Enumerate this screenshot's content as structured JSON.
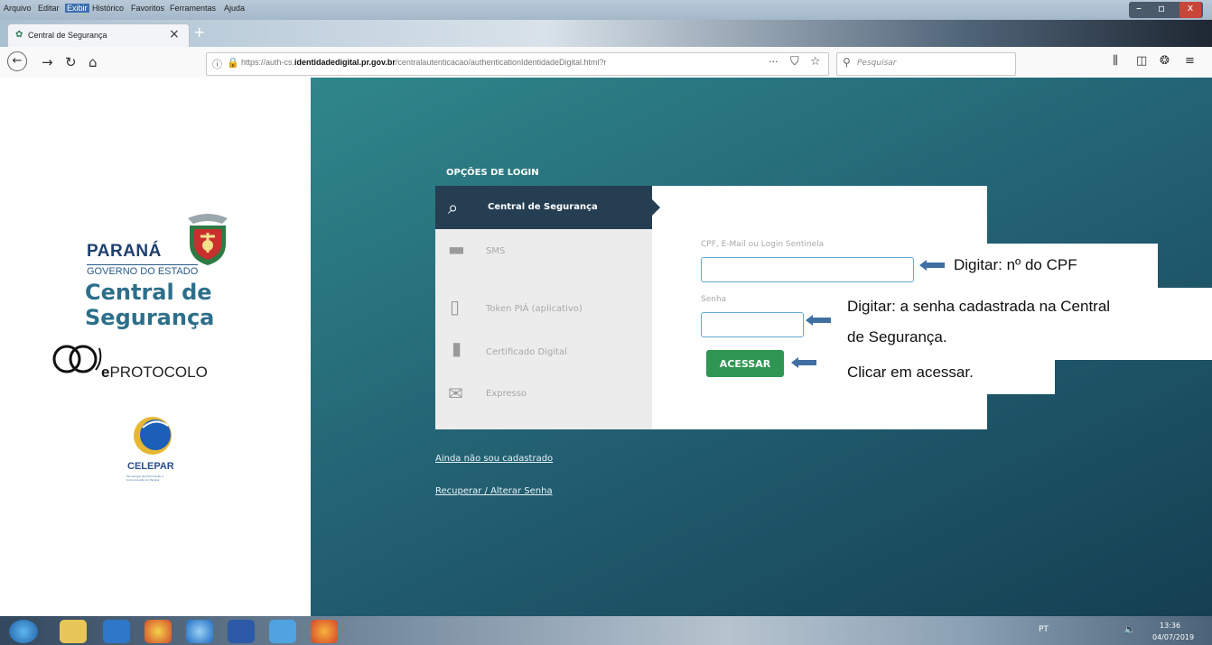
{
  "browser": {
    "menu": [
      "Arquivo",
      "Editar",
      "Exibir",
      "Histórico",
      "Favoritos",
      "Ferramentas",
      "Ajuda"
    ],
    "tab_title": "Central de Segurança",
    "tab_close": "×",
    "new_tab": "+",
    "url_prefix": "https://auth-cs.",
    "url_domain": "identidadedigital.pr.gov.br",
    "url_path": "/centralautenticacao/authenticationIdentidadeDigital.html?r",
    "url_more": "···",
    "search_placeholder": "Pesquisar",
    "win_min": "–",
    "win_max": "▫",
    "win_close": "x"
  },
  "sidebar": {
    "parana": "PARANÁ",
    "governo": "GOVERNO DO ESTADO",
    "central_l1": "Central de",
    "central_l2": "Segurança",
    "eprotocolo_e": "e",
    "eprotocolo": "PROTOCOLO",
    "celepar": "CELEPAR",
    "celepar_sub": "Tecnologia da Informação e Comunicação do Paraná"
  },
  "login": {
    "section_title": "OPÇÕES DE LOGIN",
    "options": [
      {
        "label": "Central de Segurança"
      },
      {
        "label": "SMS"
      },
      {
        "label": "Token PIÁ (aplicativo)"
      },
      {
        "label": "Certificado Digital"
      },
      {
        "label": "Expresso"
      }
    ],
    "field_user_label": "CPF, E-Mail ou Login Sentinela",
    "field_user_value": "",
    "field_pass_label": "Senha",
    "field_pass_value": "",
    "submit": "ACESSAR",
    "link_register": "Ainda não sou cadastrado",
    "link_recover": "Recuperar / Alterar Senha"
  },
  "annotations": {
    "cpf": "Digitar: nº do CPF",
    "senha_l1": "Digitar: a senha cadastrada na Central",
    "senha_l2": "de Segurança.",
    "acessar": "Clicar  em acessar.",
    "arrow_color": "#3f6fa3"
  },
  "taskbar": {
    "lang": "PT",
    "time": "13:36",
    "date": "04/07/2019"
  },
  "colors": {
    "accent_button": "#2e9652",
    "active_option_bg": "#263e52",
    "page_bg": "#236a78",
    "brand_blue": "#1f4f7a",
    "brand_teal": "#2c8a7c"
  }
}
